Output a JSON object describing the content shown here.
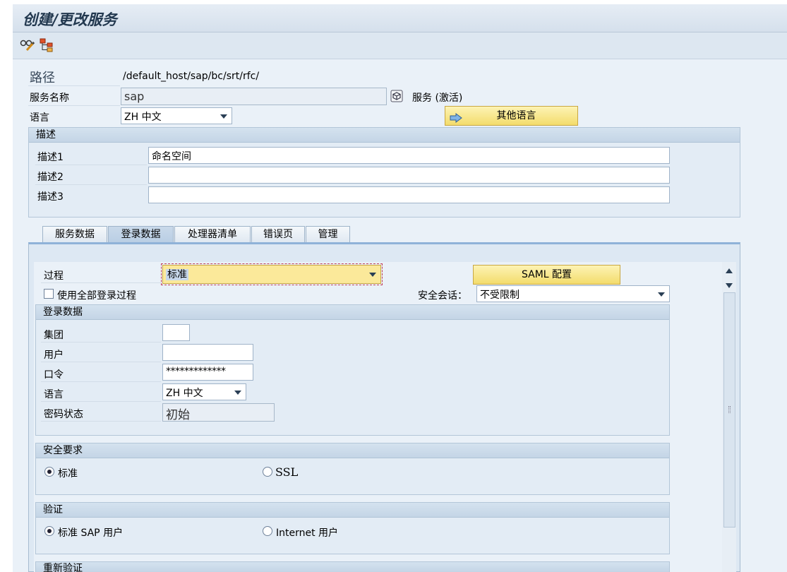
{
  "window": {
    "title": "创建/更改服务"
  },
  "header": {
    "path_label": "路径",
    "path_value": "/default_host/sap/bc/srt/rfc/",
    "service_name_label": "服务名称",
    "service_name_value": "sap",
    "service_status": "服务 (激活)",
    "language_label": "语言",
    "language_value": "ZH 中文",
    "other_languages_button": "其他语言"
  },
  "description": {
    "title": "描述",
    "rows": [
      {
        "label": "描述1",
        "value": "命名空间"
      },
      {
        "label": "描述2",
        "value": ""
      },
      {
        "label": "描述3",
        "value": ""
      }
    ]
  },
  "tabs": [
    {
      "label": "服务数据",
      "active": false
    },
    {
      "label": "登录数据",
      "active": true
    },
    {
      "label": "处理器清单",
      "active": false
    },
    {
      "label": "错误页",
      "active": false
    },
    {
      "label": "管理",
      "active": false
    }
  ],
  "logon": {
    "procedure_label": "过程",
    "procedure_value": "标准",
    "saml_button": "SAML 配置",
    "use_all_label": "使用全部登录过程",
    "security_session_label": "安全会话：",
    "security_session_value": "不受限制",
    "logon_data": {
      "title": "登录数据",
      "client_label": "集团",
      "client_value": "",
      "user_label": "用户",
      "user_value": "",
      "password_label": "口令",
      "password_value": "*************",
      "language_label": "语言",
      "language_value": "ZH 中文",
      "pw_status_label": "密码状态",
      "pw_status_value": "初始"
    },
    "security": {
      "title": "安全要求",
      "opt_standard": "标准",
      "opt_ssl": "SSL",
      "selected": "标准"
    },
    "auth": {
      "title": "验证",
      "opt_sap_user": "标准 SAP 用户",
      "opt_internet_user": "Internet 用户",
      "selected": "标准 SAP 用户"
    },
    "reauth": {
      "title": "重新验证"
    }
  },
  "icons": [
    "glasses-pencil-icon",
    "hierarchy-icon",
    "display-object-icon",
    "arrow-right-icon",
    "scroll-up-icon",
    "scroll-down-icon"
  ]
}
